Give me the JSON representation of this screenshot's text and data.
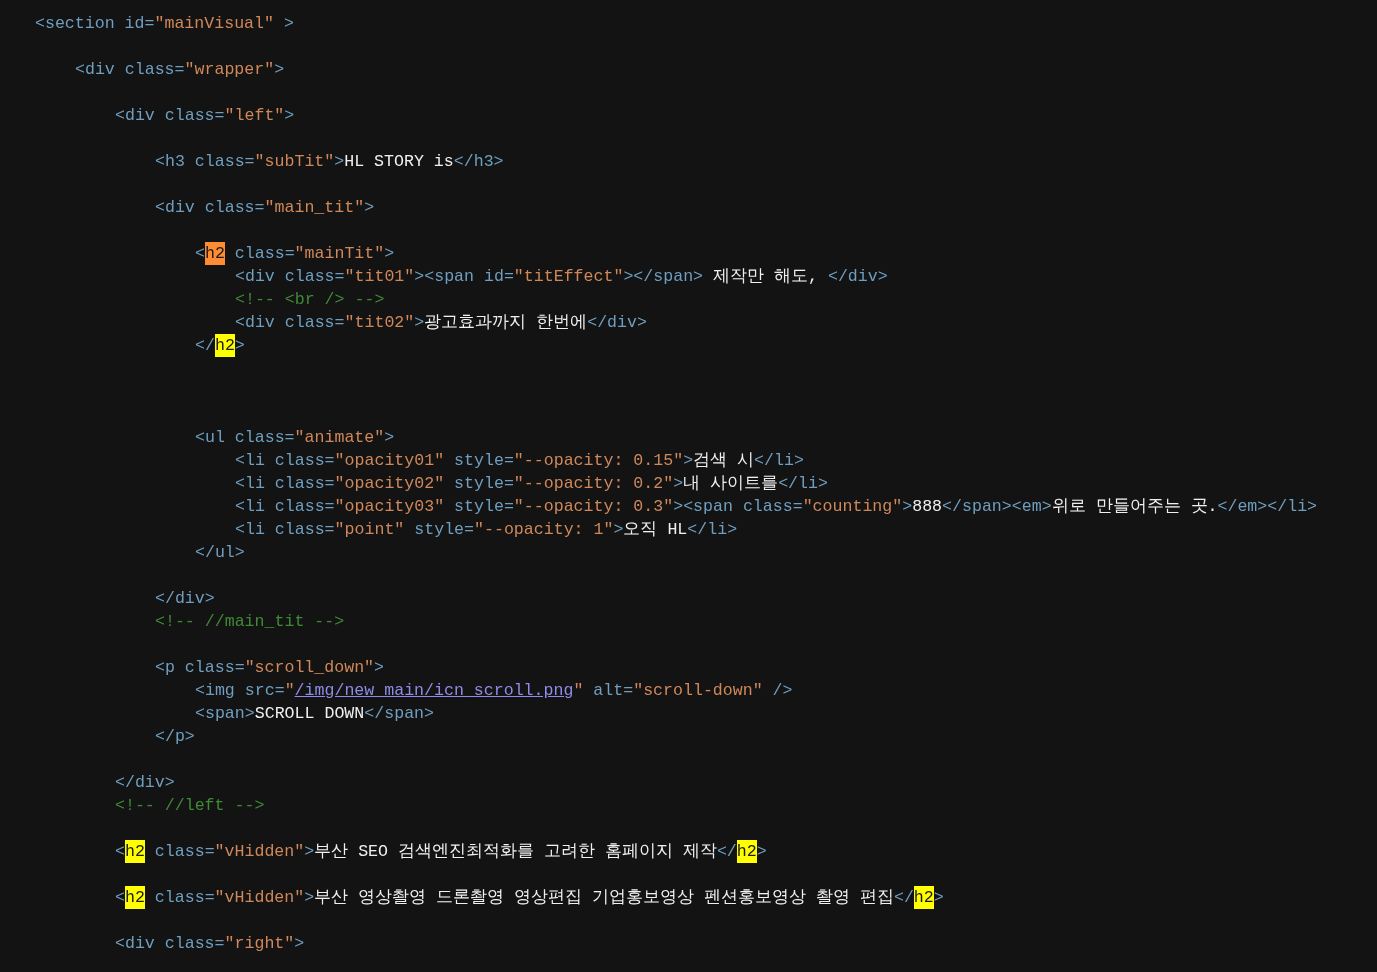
{
  "editor": {
    "lines": [
      {
        "tokens": [
          {
            "kind": "tag",
            "text": "<section id="
          },
          {
            "kind": "str",
            "text": "\"mainVisual\""
          },
          {
            "kind": "tag",
            "text": " >"
          }
        ],
        "children": [
          {
            "blank_before": true,
            "tokens": [
              {
                "kind": "tag",
                "text": "<div class="
              },
              {
                "kind": "str",
                "text": "\"wrapper\""
              },
              {
                "kind": "tag",
                "text": ">"
              }
            ],
            "children": [
              {
                "blank_before": true,
                "tokens": [
                  {
                    "kind": "tag",
                    "text": "<div class="
                  },
                  {
                    "kind": "str",
                    "text": "\"left\""
                  },
                  {
                    "kind": "tag",
                    "text": ">"
                  }
                ],
                "children": [
                  {
                    "blank_before": true,
                    "tokens": [
                      {
                        "kind": "tag",
                        "text": "<h3 class="
                      },
                      {
                        "kind": "str",
                        "text": "\"subTit\""
                      },
                      {
                        "kind": "tag",
                        "text": ">"
                      },
                      {
                        "kind": "text",
                        "text": "HL STORY is"
                      },
                      {
                        "kind": "tag",
                        "text": "</h3>"
                      }
                    ]
                  },
                  {
                    "blank_before": true,
                    "tokens": [
                      {
                        "kind": "tag",
                        "text": "<div class="
                      },
                      {
                        "kind": "str",
                        "text": "\"main_tit\""
                      },
                      {
                        "kind": "tag",
                        "text": ">"
                      }
                    ],
                    "children": [
                      {
                        "blank_before": true,
                        "tokens": [
                          {
                            "kind": "tag",
                            "text": "<"
                          },
                          {
                            "kind": "hl_current",
                            "text": "h2"
                          },
                          {
                            "kind": "tag",
                            "text": " class="
                          },
                          {
                            "kind": "str",
                            "text": "\"mainTit\""
                          },
                          {
                            "kind": "tag",
                            "text": ">"
                          }
                        ],
                        "children": [
                          {
                            "tokens": [
                              {
                                "kind": "tag",
                                "text": "<div class="
                              },
                              {
                                "kind": "str",
                                "text": "\"tit01\""
                              },
                              {
                                "kind": "tag",
                                "text": "><span id="
                              },
                              {
                                "kind": "str",
                                "text": "\"titEffect\""
                              },
                              {
                                "kind": "tag",
                                "text": "></span>"
                              },
                              {
                                "kind": "text",
                                "text": " 제작만 해도, "
                              },
                              {
                                "kind": "tag",
                                "text": "</div>"
                              }
                            ]
                          },
                          {
                            "tokens": [
                              {
                                "kind": "comment",
                                "text": "<!-- <br /> -->"
                              }
                            ]
                          },
                          {
                            "tokens": [
                              {
                                "kind": "tag",
                                "text": "<div class="
                              },
                              {
                                "kind": "str",
                                "text": "\"tit02\""
                              },
                              {
                                "kind": "tag",
                                "text": ">"
                              },
                              {
                                "kind": "text",
                                "text": "광고효과까지 한번에"
                              },
                              {
                                "kind": "tag",
                                "text": "</div>"
                              }
                            ]
                          }
                        ]
                      },
                      {
                        "tokens": [
                          {
                            "kind": "tag",
                            "text": "</"
                          },
                          {
                            "kind": "hl_match",
                            "text": "h2"
                          },
                          {
                            "kind": "tag",
                            "text": ">"
                          }
                        ]
                      },
                      {
                        "large_gap_before": true,
                        "tokens": [
                          {
                            "kind": "tag",
                            "text": "<ul class="
                          },
                          {
                            "kind": "str",
                            "text": "\"animate\""
                          },
                          {
                            "kind": "tag",
                            "text": ">"
                          }
                        ],
                        "children": [
                          {
                            "tokens": [
                              {
                                "kind": "tag",
                                "text": "<li class="
                              },
                              {
                                "kind": "str",
                                "text": "\"opacity01\""
                              },
                              {
                                "kind": "tag",
                                "text": " style="
                              },
                              {
                                "kind": "str",
                                "text": "\"--opacity: 0.15\""
                              },
                              {
                                "kind": "tag",
                                "text": ">"
                              },
                              {
                                "kind": "text",
                                "text": "검색 시"
                              },
                              {
                                "kind": "tag",
                                "text": "</li>"
                              }
                            ]
                          },
                          {
                            "tokens": [
                              {
                                "kind": "tag",
                                "text": "<li class="
                              },
                              {
                                "kind": "str",
                                "text": "\"opacity02\""
                              },
                              {
                                "kind": "tag",
                                "text": " style="
                              },
                              {
                                "kind": "str",
                                "text": "\"--opacity: 0.2\""
                              },
                              {
                                "kind": "tag",
                                "text": ">"
                              },
                              {
                                "kind": "text",
                                "text": "내 사이트를"
                              },
                              {
                                "kind": "tag",
                                "text": "</li>"
                              }
                            ]
                          },
                          {
                            "tokens": [
                              {
                                "kind": "tag",
                                "text": "<li class="
                              },
                              {
                                "kind": "str",
                                "text": "\"opacity03\""
                              },
                              {
                                "kind": "tag",
                                "text": " style="
                              },
                              {
                                "kind": "str",
                                "text": "\"--opacity: 0.3\""
                              },
                              {
                                "kind": "tag",
                                "text": "><span class="
                              },
                              {
                                "kind": "str",
                                "text": "\"counting\""
                              },
                              {
                                "kind": "tag",
                                "text": ">"
                              },
                              {
                                "kind": "text",
                                "text": "888"
                              },
                              {
                                "kind": "tag",
                                "text": "</span><em>"
                              },
                              {
                                "kind": "text",
                                "text": "위로 만들어주는 곳."
                              },
                              {
                                "kind": "tag",
                                "text": "</em></li>"
                              }
                            ]
                          },
                          {
                            "tokens": [
                              {
                                "kind": "tag",
                                "text": "<li class="
                              },
                              {
                                "kind": "str",
                                "text": "\"point\""
                              },
                              {
                                "kind": "tag",
                                "text": " style="
                              },
                              {
                                "kind": "str",
                                "text": "\"--opacity: 1\""
                              },
                              {
                                "kind": "tag",
                                "text": ">"
                              },
                              {
                                "kind": "text",
                                "text": "오직 HL"
                              },
                              {
                                "kind": "tag",
                                "text": "</li>"
                              }
                            ]
                          }
                        ]
                      },
                      {
                        "tokens": [
                          {
                            "kind": "tag",
                            "text": "</ul>"
                          }
                        ]
                      }
                    ]
                  },
                  {
                    "blank_before": true,
                    "tokens": [
                      {
                        "kind": "tag",
                        "text": "</div>"
                      }
                    ]
                  },
                  {
                    "tokens": [
                      {
                        "kind": "comment",
                        "text": "<!-- //main_tit -->"
                      }
                    ]
                  },
                  {
                    "blank_before": true,
                    "tokens": [
                      {
                        "kind": "tag",
                        "text": "<p class="
                      },
                      {
                        "kind": "str",
                        "text": "\"scroll_down\""
                      },
                      {
                        "kind": "tag",
                        "text": ">"
                      }
                    ],
                    "children": [
                      {
                        "tokens": [
                          {
                            "kind": "tag",
                            "text": "<img src="
                          },
                          {
                            "kind": "str",
                            "text": "\""
                          },
                          {
                            "kind": "link",
                            "text": "/img/new_main/icn_scroll.png"
                          },
                          {
                            "kind": "str",
                            "text": "\""
                          },
                          {
                            "kind": "tag",
                            "text": " alt="
                          },
                          {
                            "kind": "str",
                            "text": "\"scroll-down\""
                          },
                          {
                            "kind": "tag",
                            "text": " />"
                          }
                        ]
                      },
                      {
                        "tokens": [
                          {
                            "kind": "tag",
                            "text": "<span>"
                          },
                          {
                            "kind": "text",
                            "text": "SCROLL DOWN"
                          },
                          {
                            "kind": "tag",
                            "text": "</span>"
                          }
                        ]
                      }
                    ]
                  },
                  {
                    "tokens": [
                      {
                        "kind": "tag",
                        "text": "</p>"
                      }
                    ]
                  }
                ]
              },
              {
                "blank_before": true,
                "tokens": [
                  {
                    "kind": "tag",
                    "text": "</div>"
                  }
                ]
              },
              {
                "tokens": [
                  {
                    "kind": "comment",
                    "text": "<!-- //left -->"
                  }
                ]
              },
              {
                "blank_before": true,
                "tokens": [
                  {
                    "kind": "tag",
                    "text": "<"
                  },
                  {
                    "kind": "hl_match",
                    "text": "h2"
                  },
                  {
                    "kind": "tag",
                    "text": " class="
                  },
                  {
                    "kind": "str",
                    "text": "\"vHidden\""
                  },
                  {
                    "kind": "tag",
                    "text": ">"
                  },
                  {
                    "kind": "text",
                    "text": "부산 SEO 검색엔진최적화를 고려한 홈페이지 제작"
                  },
                  {
                    "kind": "tag",
                    "text": "</"
                  },
                  {
                    "kind": "hl_match",
                    "text": "h2"
                  },
                  {
                    "kind": "tag",
                    "text": ">"
                  }
                ]
              },
              {
                "blank_before": true,
                "tokens": [
                  {
                    "kind": "tag",
                    "text": "<"
                  },
                  {
                    "kind": "hl_match",
                    "text": "h2"
                  },
                  {
                    "kind": "tag",
                    "text": " class="
                  },
                  {
                    "kind": "str",
                    "text": "\"vHidden\""
                  },
                  {
                    "kind": "tag",
                    "text": ">"
                  },
                  {
                    "kind": "text",
                    "text": "부산 영상촬영 드론촬영 영상편집 기업홍보영상 펜션홍보영상 촬영 편집"
                  },
                  {
                    "kind": "tag",
                    "text": "</"
                  },
                  {
                    "kind": "hl_match",
                    "text": "h2"
                  },
                  {
                    "kind": "tag",
                    "text": ">"
                  }
                ]
              },
              {
                "blank_before": true,
                "tokens": [
                  {
                    "kind": "tag",
                    "text": "<div class="
                  },
                  {
                    "kind": "str",
                    "text": "\"right\""
                  },
                  {
                    "kind": "tag",
                    "text": ">"
                  }
                ]
              }
            ]
          }
        ]
      }
    ]
  }
}
